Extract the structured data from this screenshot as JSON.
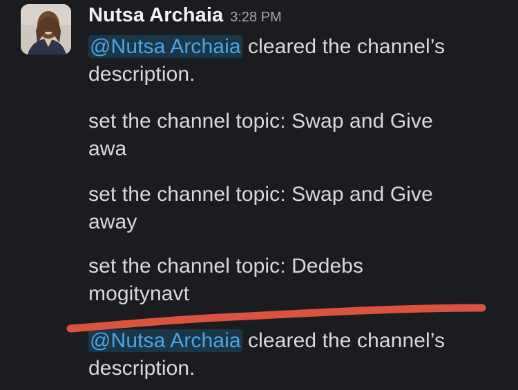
{
  "message": {
    "author": "Nutsa Archaia",
    "timestamp": "3:28 PM",
    "avatar_icon": "user-avatar-photo"
  },
  "events": [
    {
      "mention": "@Nutsa Archaia",
      "text_line1": " cleared the channel’s",
      "text_line2": "description."
    },
    {
      "text_line1": "set the channel topic: Swap and Give",
      "text_line2": "awa"
    },
    {
      "text_line1": "set the channel topic: Swap and Give",
      "text_line2": "away"
    },
    {
      "text_line1": "set the channel topic: Dedebs",
      "text_line2": "mogitynavt"
    },
    {
      "mention": "@Nutsa Archaia",
      "text_line1": " cleared the channel’s",
      "text_line2": "description."
    }
  ],
  "colors": {
    "background": "#1b1c20",
    "mention": "#4aa5ea",
    "mention_bg": "#1d9bd1",
    "annotation_line": "#d9533f"
  }
}
